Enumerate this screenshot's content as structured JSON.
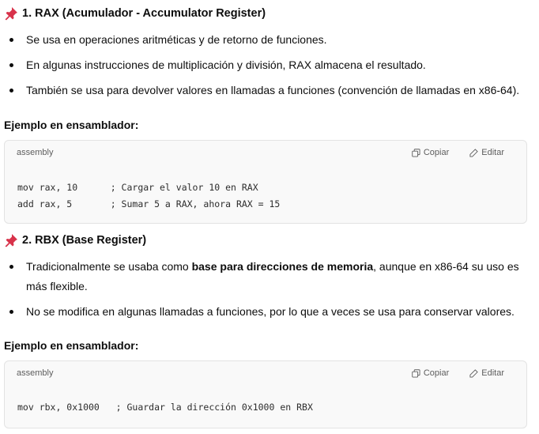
{
  "sections": [
    {
      "title": "1. RAX (Acumulador - Accumulator Register)",
      "bullets": [
        {
          "plain": "Se usa en operaciones aritméticas y de retorno de funciones."
        },
        {
          "plain": "En algunas instrucciones de multiplicación y división, RAX almacena el resultado."
        },
        {
          "plain": "También se usa para devolver valores en llamadas a funciones (convención de llamadas en x86-64)."
        }
      ],
      "example_label": "Ejemplo en ensamblador:",
      "code": {
        "language": "assembly",
        "copy_label": "Copiar",
        "edit_label": "Editar",
        "lines": [
          "mov rax, 10      ; Cargar el valor 10 en RAX",
          "add rax, 5       ; Sumar 5 a RAX, ahora RAX = 15"
        ]
      }
    },
    {
      "title": "2. RBX (Base Register)",
      "bullets": [
        {
          "before": "Tradicionalmente se usaba como ",
          "bold": "base para direcciones de memoria",
          "after": ", aunque en x86-64 su uso es",
          "line2": "más flexible."
        },
        {
          "plain": "No se modifica en algunas llamadas a funciones, por lo que a veces se usa para conservar valores."
        }
      ],
      "example_label": "Ejemplo en ensamblador:",
      "code": {
        "language": "assembly",
        "copy_label": "Copiar",
        "edit_label": "Editar",
        "lines": [
          "mov rbx, 0x1000   ; Guardar la dirección 0x1000 en RBX"
        ]
      }
    }
  ],
  "colors": {
    "pin": "#d8324a",
    "code_bg": "#f9f9f9",
    "border": "#e3e3e3"
  },
  "icons": {
    "section": "pushpin-icon",
    "copy": "copy-icon",
    "edit": "edit-icon"
  }
}
